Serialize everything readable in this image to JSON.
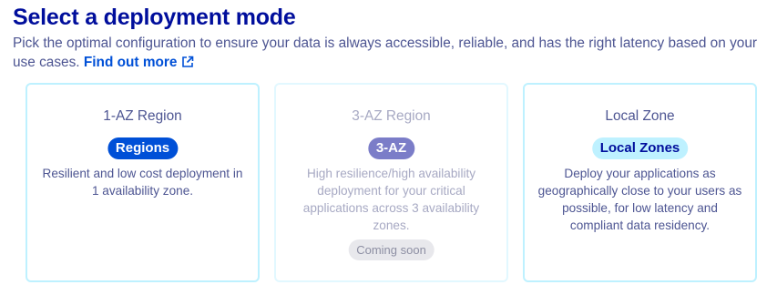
{
  "header": {
    "title": "Select a deployment mode",
    "description": "Pick the optimal configuration to ensure your data is always accessible, reliable, and has the right latency based on your use cases.",
    "link_label": "Find out more"
  },
  "cards": [
    {
      "title": "1-AZ Region",
      "badge": "Regions",
      "text": "Resilient and low cost deployment in 1 availability zone."
    },
    {
      "title": "3-AZ Region",
      "badge": "3-AZ",
      "text": "High resilience/high availability deployment for your critical applications across 3 availability zones.",
      "status": "Coming soon"
    },
    {
      "title": "Local Zone",
      "badge": "Local Zones",
      "text": "Deploy your applications as geographically close to your users as possible, for low latency and compliant data residency."
    }
  ],
  "colors": {
    "title": "#000e9c",
    "link": "#0050d7",
    "card_border": "#bef1ff",
    "badge_regions": "#0050d7",
    "badge_3az": "#7b7dc8",
    "badge_local": "#bef1ff"
  },
  "icons": {
    "link_icon": "external-link-icon"
  }
}
